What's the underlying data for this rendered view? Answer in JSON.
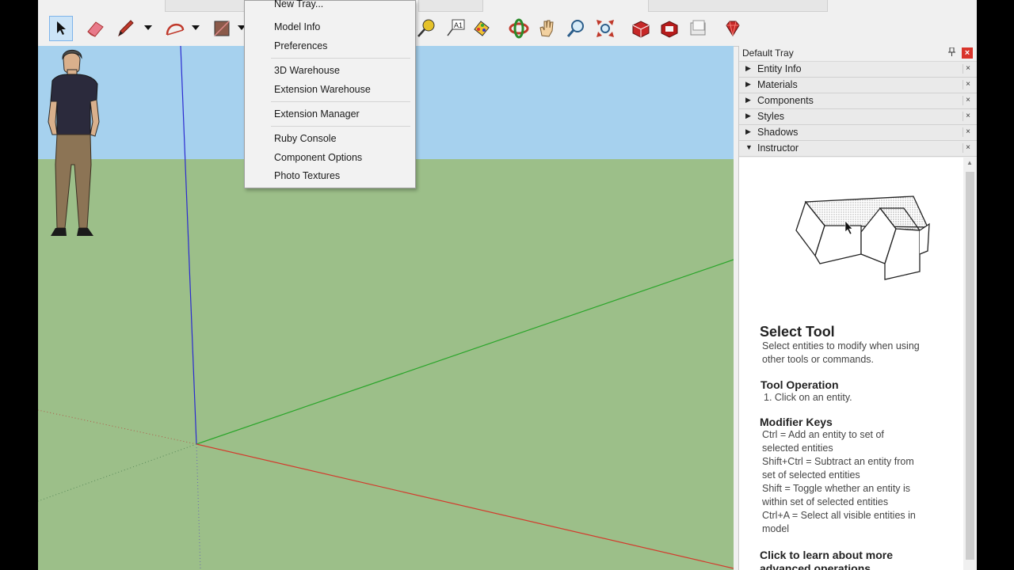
{
  "context_menu": {
    "items": [
      "New Tray...",
      "Model Info",
      "Preferences",
      "3D Warehouse",
      "Extension Warehouse",
      "Extension Manager",
      "Ruby Console",
      "Component Options",
      "Photo Textures"
    ]
  },
  "tray": {
    "title": "Default Tray",
    "pin_icon": "pin-icon",
    "close_label": "×",
    "panels": [
      {
        "label": "Entity Info",
        "expanded": false
      },
      {
        "label": "Materials",
        "expanded": false
      },
      {
        "label": "Components",
        "expanded": false
      },
      {
        "label": "Styles",
        "expanded": false
      },
      {
        "label": "Shadows",
        "expanded": false
      },
      {
        "label": "Instructor",
        "expanded": true
      }
    ],
    "panel_close": "×",
    "arrow_collapsed": "▶",
    "arrow_expanded": "▼"
  },
  "instructor": {
    "title": "Select Tool",
    "description": [
      "Select entities to modify when using",
      "other tools or commands."
    ],
    "operation_heading": "Tool Operation",
    "operation_steps": [
      "1. Click on an entity."
    ],
    "modifier_heading": "Modifier Keys",
    "modifier_lines": [
      "Ctrl = Add an entity to set of",
      "selected entities",
      "Shift+Ctrl = Subtract an entity from",
      "set of selected entities",
      "Shift = Toggle whether an entity is",
      "within set of selected entities",
      "Ctrl+A = Select all visible entities in",
      "model"
    ],
    "learn_more": [
      "Click to learn about more",
      "advanced operations"
    ]
  },
  "toolbar": {
    "icons": [
      "select-tool-icon",
      "eraser-tool-icon",
      "pencil-tool-icon",
      "arc-tool-icon",
      "shape-tool-icon",
      "tape-measure-icon",
      "text-tool-icon",
      "paint-bucket-icon",
      "orbit-icon",
      "pan-icon",
      "zoom-icon",
      "zoom-extents-icon",
      "3d-warehouse-icon",
      "extension-warehouse-icon",
      "layout-icon",
      "ruby-icon"
    ]
  },
  "colors": {
    "sky": "#a6d1ee",
    "ground": "#9cbf89",
    "axis_red": "#d33a2c",
    "axis_green": "#2aa52a",
    "axis_blue": "#2a2ad0",
    "accent": "#d9342b"
  }
}
